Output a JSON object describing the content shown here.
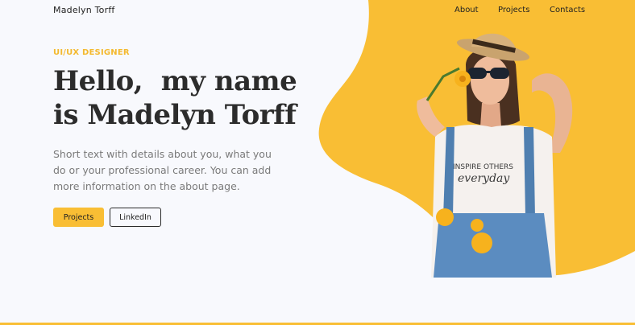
{
  "brand": {
    "name": "Madelyn Torff"
  },
  "nav": {
    "items": [
      "About",
      "Projects",
      "Contacts"
    ]
  },
  "hero": {
    "tagline": "UI/UX DESIGNER",
    "headline_line1": "Hello,  my name",
    "headline_line2": "is Madelyn Torff",
    "bio": "Short text with details about you, what you do or your professional career. You can add more information on the about page.",
    "primary_button": "Projects",
    "secondary_button": "LinkedIn",
    "shirt_text_top": "INSPIRE OTHERS",
    "shirt_text_bottom": "everyday"
  },
  "colors": {
    "accent": "#f9be34",
    "background": "#f8f9fd",
    "heading": "#2c2c2c",
    "body_text": "#7a7a7a"
  },
  "icons": [
    "portrait-photo"
  ]
}
